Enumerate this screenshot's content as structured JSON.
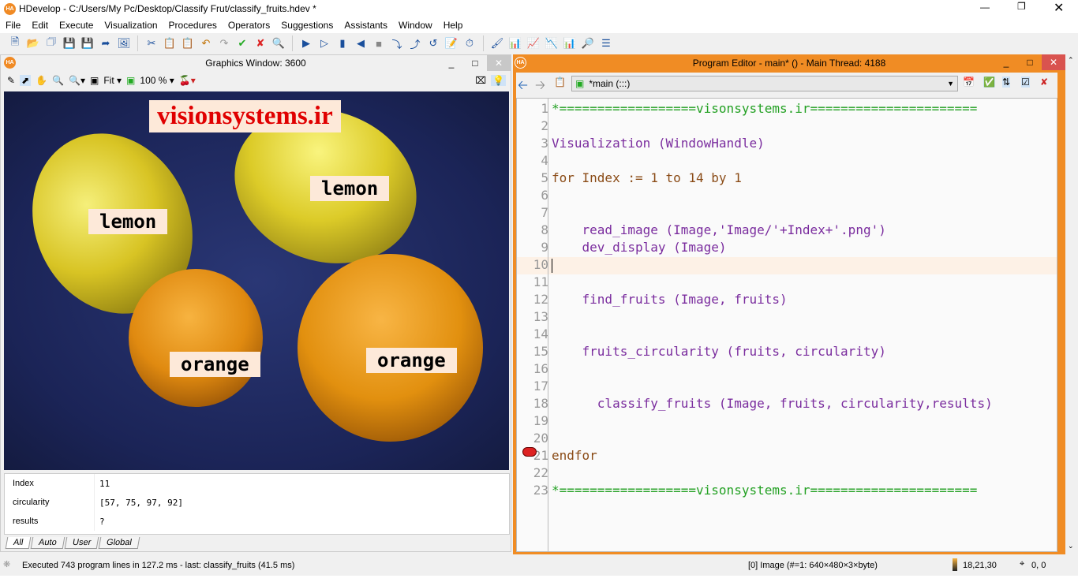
{
  "app": {
    "title": "HDevelop - C:/Users/My Pc/Desktop/Classify Frut/classify_fruits.hdev *",
    "logo": "HA"
  },
  "menu": [
    "File",
    "Edit",
    "Execute",
    "Visualization",
    "Procedures",
    "Operators",
    "Suggestions",
    "Assistants",
    "Window",
    "Help"
  ],
  "graphics": {
    "title": "Graphics Window: 3600",
    "zoom_fit": "Fit",
    "zoom_pct": "100 %",
    "watermark": "visionsystems.ir",
    "labels": [
      "lemon",
      "lemon",
      "orange",
      "orange"
    ]
  },
  "variables": [
    {
      "name": "Index",
      "value": "11"
    },
    {
      "name": "circularity",
      "value": "[57, 75, 97, 92]"
    },
    {
      "name": "results",
      "value": "?"
    }
  ],
  "var_tabs": [
    "All",
    "Auto",
    "User",
    "Global"
  ],
  "editor": {
    "title": "Program Editor - main* () - Main Thread: 4188",
    "procedure": "*main (:::)",
    "lines": [
      {
        "n": "1",
        "t": "*==================visonsystems.ir======================",
        "c": "c-com"
      },
      {
        "n": "2",
        "t": "",
        "c": ""
      },
      {
        "n": "3",
        "t": "Visualization (WindowHandle)",
        "c": "c-op"
      },
      {
        "n": "4",
        "t": "",
        "c": ""
      },
      {
        "n": "5",
        "t": "for Index := 1 to 14 by 1",
        "c": "c-kw"
      },
      {
        "n": "6",
        "t": "",
        "c": ""
      },
      {
        "n": "7",
        "t": "",
        "c": ""
      },
      {
        "n": "8",
        "t": "    read_image (Image,'Image/'+Index+'.png')",
        "c": "c-op"
      },
      {
        "n": "9",
        "t": "    dev_display (Image)",
        "c": "c-op"
      },
      {
        "n": "10",
        "t": "",
        "c": ""
      },
      {
        "n": "11",
        "t": "",
        "c": ""
      },
      {
        "n": "12",
        "t": "    find_fruits (Image, fruits)",
        "c": "c-op"
      },
      {
        "n": "13",
        "t": "",
        "c": ""
      },
      {
        "n": "14",
        "t": "",
        "c": ""
      },
      {
        "n": "15",
        "t": "    fruits_circularity (fruits, circularity)",
        "c": "c-op"
      },
      {
        "n": "16",
        "t": "",
        "c": ""
      },
      {
        "n": "17",
        "t": "",
        "c": ""
      },
      {
        "n": "18",
        "t": "      classify_fruits (Image, fruits, circularity,results)",
        "c": "c-op"
      },
      {
        "n": "19",
        "t": "",
        "c": ""
      },
      {
        "n": "20",
        "t": "",
        "c": ""
      },
      {
        "n": "21",
        "t": "endfor",
        "c": "c-kw"
      },
      {
        "n": "22",
        "t": "",
        "c": ""
      },
      {
        "n": "23",
        "t": "*==================visonsystems.ir======================",
        "c": "c-com"
      }
    ]
  },
  "status": {
    "message": "Executed 743 program lines in 127.2 ms - last: classify_fruits (41.5 ms)",
    "image": "[0] Image (#=1: 640×480×3×byte)",
    "pixel": "18,21,30",
    "coords": "0, 0"
  },
  "colors": {
    "accent": "#f08c24",
    "comment": "#22a022",
    "operator": "#7a2c9e",
    "keyword": "#8a4b16"
  }
}
